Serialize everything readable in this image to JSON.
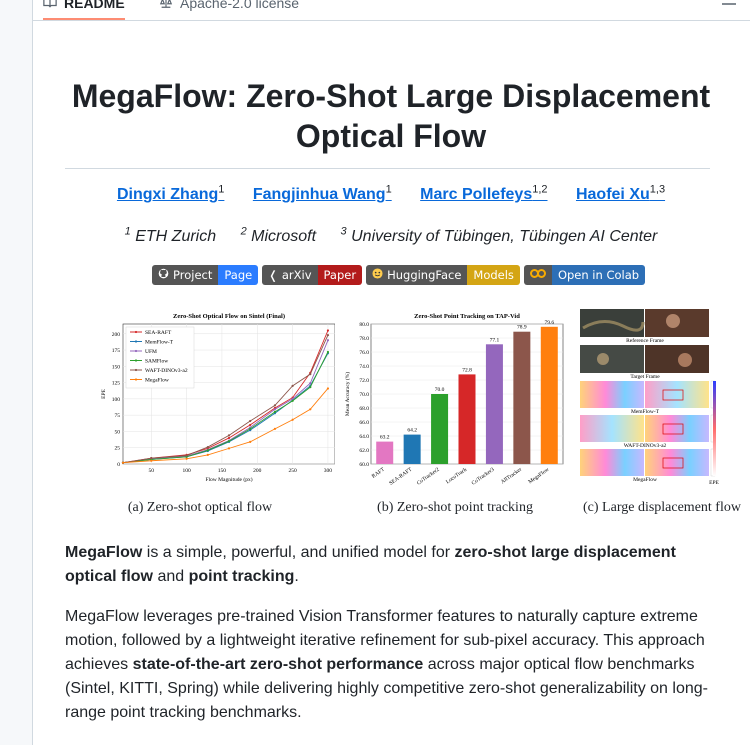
{
  "tabs": [
    {
      "label": "README",
      "icon": "book-icon",
      "active": true
    },
    {
      "label": "Apache-2.0 license",
      "icon": "scale-icon",
      "active": false
    }
  ],
  "readme": {
    "title": "MegaFlow: Zero-Shot Large Displacement Optical Flow",
    "authors": [
      {
        "name": "Dingxi Zhang",
        "sup": "1"
      },
      {
        "name": "Fangjinhua Wang",
        "sup": "1"
      },
      {
        "name": "Marc Pollefeys",
        "sup": "1,2"
      },
      {
        "name": "Haofei Xu",
        "sup": "1,3"
      }
    ],
    "affiliations": [
      {
        "sup": "1",
        "name": "ETH Zurich"
      },
      {
        "sup": "2",
        "name": "Microsoft"
      },
      {
        "sup": "3",
        "name": "University of Tübingen, Tübingen AI Center"
      }
    ],
    "badges": [
      {
        "left": "Project",
        "right": "Page",
        "color": "#2b7cff",
        "icon": "github-icon"
      },
      {
        "left": "arXiv",
        "right": "Paper",
        "color": "#b31b1b",
        "icon": "arxiv-icon"
      },
      {
        "left": "HuggingFace",
        "right": "Models",
        "color": "#d4a514",
        "icon": "huggingface-icon"
      },
      {
        "left": "",
        "right": "Open in Colab",
        "color": "#2d6fb6",
        "icon": "colab-icon"
      }
    ],
    "figure_captions": [
      "(a) Zero-shot optical flow",
      "(b) Zero-shot point tracking",
      "(c) Large displacement flow"
    ],
    "fig_c_labels": [
      "Reference Frame",
      "Target Frame",
      "MemFlow-T",
      "WAFT-DINOv3-a2",
      "MegaFlow",
      "EPE"
    ],
    "para1": {
      "a": "MegaFlow",
      "b": " is a simple, powerful, and unified model for ",
      "c": "zero-shot large displacement optical flow",
      "d": " and ",
      "e": "point tracking",
      "f": "."
    },
    "para2": {
      "a": "MegaFlow leverages pre-trained Vision Transformer features to naturally capture extreme motion, followed by a lightweight iterative refinement for sub-pixel accuracy. This approach achieves ",
      "b": "state-of-the-art zero-shot performance",
      "c": " across major optical flow benchmarks (Sintel, KITTI, Spring) while delivering highly competitive zero-shot generalizability on long-range point tracking benchmarks."
    }
  },
  "chart_data": [
    {
      "type": "line",
      "title": "Zero-Shot Optical Flow on Sintel (Final)",
      "xlabel": "Flow Magnitude (px)",
      "ylabel": "EPE",
      "x": [
        10,
        50,
        100,
        130,
        160,
        190,
        225,
        250,
        275,
        300
      ],
      "xticks": [
        50,
        100,
        150,
        200,
        250,
        300
      ],
      "yticks": [
        0,
        25,
        50,
        75,
        100,
        125,
        150,
        175,
        200
      ],
      "xlim": [
        10,
        310
      ],
      "ylim": [
        0,
        215
      ],
      "legend_position": "top-left",
      "series": [
        {
          "name": "SEA-RAFT",
          "color": "#d62728",
          "values": [
            2,
            9,
            14,
            24,
            40,
            60,
            86,
            102,
            140,
            205
          ]
        },
        {
          "name": "MemFlow-T",
          "color": "#1f77b4",
          "values": [
            2,
            7,
            11,
            20,
            34,
            52,
            78,
            98,
            120,
            170
          ]
        },
        {
          "name": "UFM",
          "color": "#9467bd",
          "values": [
            2,
            8,
            12,
            22,
            36,
            56,
            84,
            100,
            124,
            190
          ]
        },
        {
          "name": "SAMFlow",
          "color": "#2ca02c",
          "values": [
            2,
            7,
            11,
            21,
            35,
            54,
            80,
            97,
            118,
            172
          ]
        },
        {
          "name": "WAFT-DINOv3-a2",
          "color": "#8c564b",
          "values": [
            2,
            9,
            13,
            26,
            44,
            66,
            90,
            120,
            138,
            198
          ]
        },
        {
          "name": "MegaFlow",
          "color": "#ff7f0e",
          "values": [
            2,
            5,
            8,
            14,
            24,
            34,
            54,
            68,
            84,
            116
          ]
        }
      ]
    },
    {
      "type": "bar",
      "title": "Zero-Shot Point Tracking on TAP-Vid",
      "ylabel": "Mean Accuracy (%)",
      "categories": [
        "RAFT",
        "SEA-RAFT",
        "CoTracker2",
        "LocoTrack",
        "CoTracker3",
        "AllTracker",
        "MegaFlow"
      ],
      "values": [
        63.2,
        64.2,
        70.0,
        72.8,
        77.1,
        78.9,
        79.6
      ],
      "colors": [
        "#e377c2",
        "#1f77b4",
        "#2ca02c",
        "#d62728",
        "#9467bd",
        "#8c564b",
        "#ff7f0e"
      ],
      "ylim": [
        60,
        80
      ],
      "yticks": [
        60.0,
        62.0,
        64.0,
        66.0,
        68.0,
        70.0,
        72.0,
        74.0,
        76.0,
        78.0,
        80.0
      ]
    }
  ]
}
